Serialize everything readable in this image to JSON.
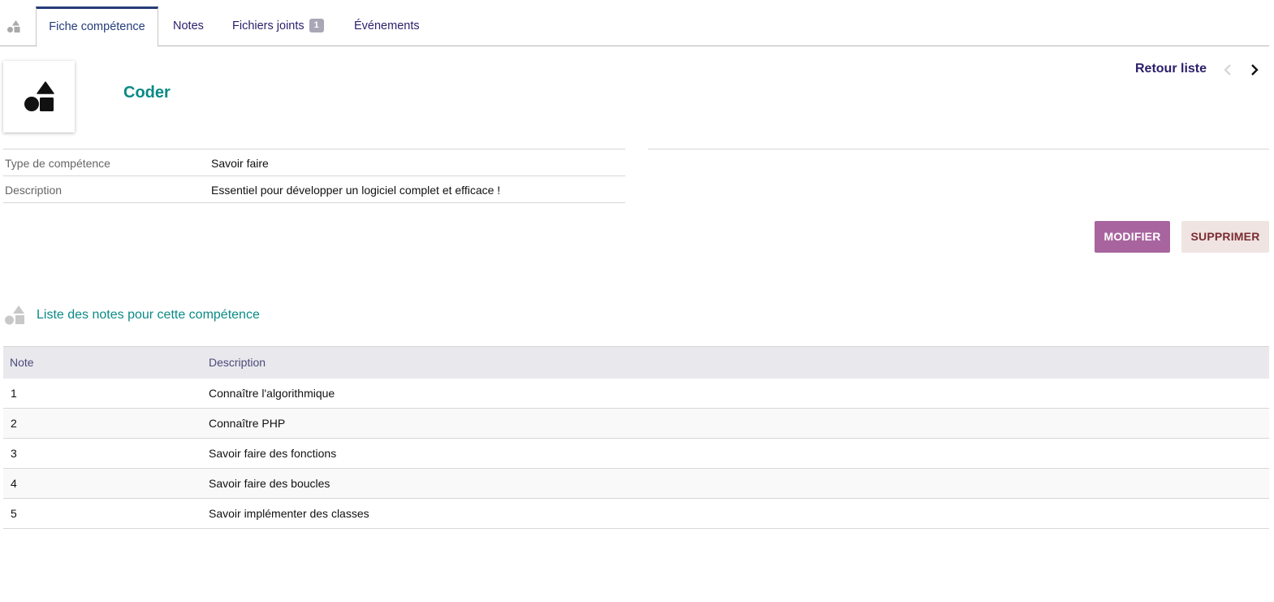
{
  "tabs": {
    "fiche": "Fiche compétence",
    "notes": "Notes",
    "files": "Fichiers joints",
    "files_count": "1",
    "events": "Événements"
  },
  "record": {
    "title": "Coder",
    "back_label": "Retour liste"
  },
  "fields": [
    {
      "label": "Type de compétence",
      "value": "Savoir faire"
    },
    {
      "label": "Description",
      "value": "Essentiel pour développer un logiciel complet et efficace !"
    }
  ],
  "actions": {
    "modify": "MODIFIER",
    "delete": "SUPPRIMER"
  },
  "notes_section": {
    "title": "Liste des notes pour cette compétence",
    "columns": [
      "Note",
      "Description"
    ],
    "rows": [
      {
        "note": "1",
        "description": "Connaître l'algorithmique"
      },
      {
        "note": "2",
        "description": "Connaître PHP"
      },
      {
        "note": "3",
        "description": "Savoir faire des fonctions"
      },
      {
        "note": "4",
        "description": "Savoir faire des boucles"
      },
      {
        "note": "5",
        "description": "Savoir implémenter des classes"
      }
    ]
  },
  "colors": {
    "accent_teal": "#0b8a86",
    "nav_dark": "#2b1f6b",
    "modify_bg": "#a8649f",
    "delete_bg": "#efe4e1",
    "delete_text": "#7b2b33",
    "table_head_bg": "#e9e9ed",
    "row_alt_bg": "#f9f9f9"
  },
  "icons": {
    "module": "shapes-icon",
    "prev": "chevron-left-icon",
    "next": "chevron-right-icon"
  }
}
